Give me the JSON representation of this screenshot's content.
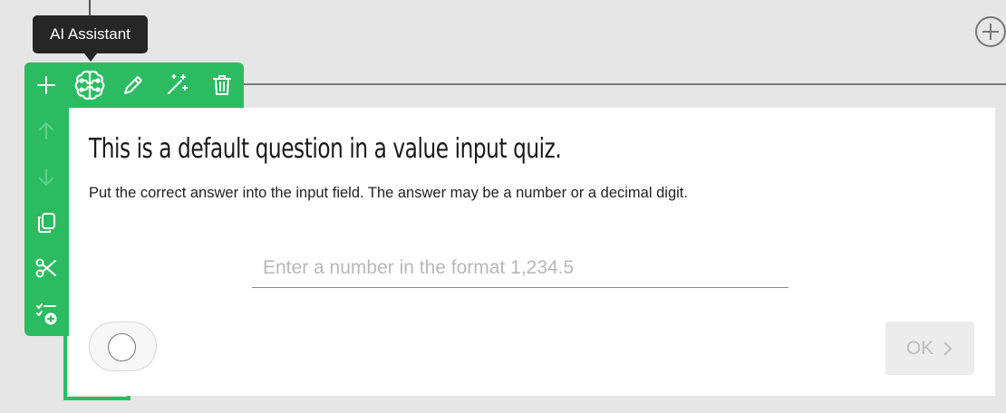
{
  "tooltip": {
    "text": "AI Assistant"
  },
  "toolbar": {
    "horizontal": [
      "plus-icon",
      "brain-icon",
      "pencil-icon",
      "magic-wand-icon",
      "trash-icon"
    ],
    "vertical": [
      "arrow-up-icon",
      "arrow-down-icon",
      "copy-icon",
      "scissors-icon",
      "checklist-add-icon"
    ]
  },
  "question": {
    "title": "This is a default question in a value input quiz.",
    "description": "Put the correct answer into the input field. The answer may be a number or a decimal digit.",
    "input_value": "",
    "input_placeholder": "Enter a number in the format 1,234.5"
  },
  "ok_button": {
    "label": "OK"
  },
  "colors": {
    "accent": "#2dbb62",
    "tooltip_bg": "#262626",
    "background": "#e6e6e6"
  }
}
